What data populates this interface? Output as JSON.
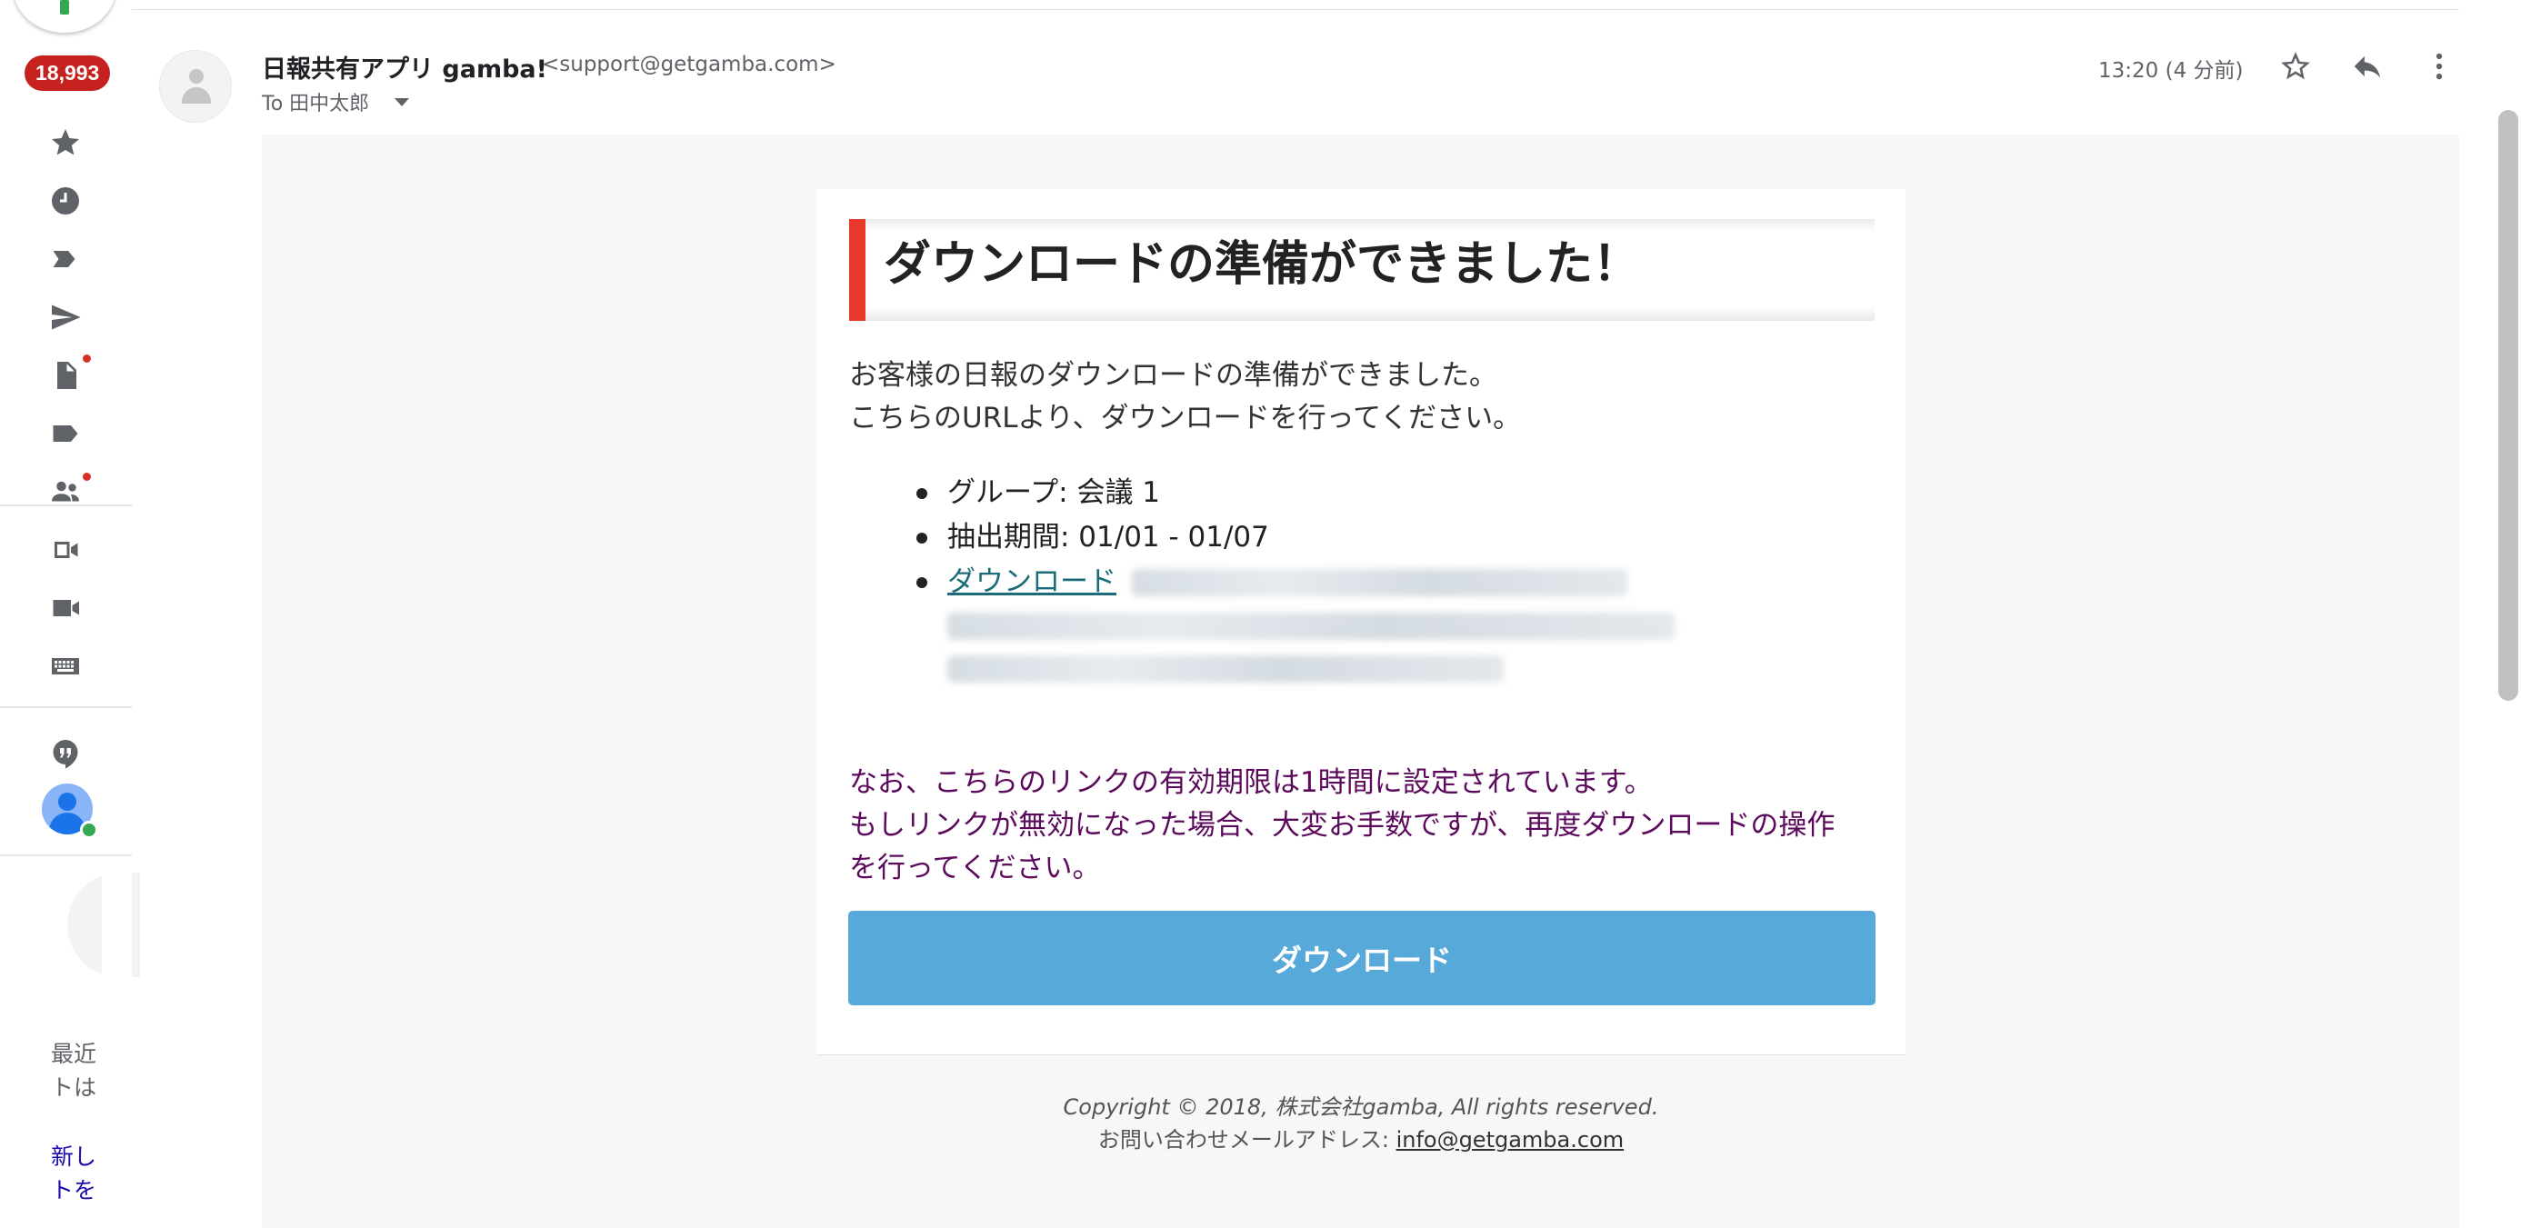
{
  "rail": {
    "unread_badge": "18,993",
    "icons": [
      "star-icon",
      "clock-icon",
      "important-icon",
      "send-icon",
      "draft-icon",
      "label-icon",
      "people-icon",
      "video-outline-icon",
      "video-icon",
      "keyboard-icon",
      "hangouts-icon"
    ],
    "recent_text_line1": "最近",
    "recent_text_line2": "トは",
    "new_link_line1": "新し",
    "new_link_line2": "トを"
  },
  "email": {
    "sender_name": "日報共有アプリ gamba!",
    "sender_email": "<support@getgamba.com>",
    "to_line": "To 田中太郎",
    "timestamp": "13:20 (4 分前)"
  },
  "body": {
    "title": "ダウンロードの準備ができました！",
    "intro_line1": "お客様の日報のダウンロードの準備ができました。",
    "intro_line2": "こちらのURLより、ダウンロードを行ってください。",
    "detail_group": "グループ: 会議 1",
    "detail_period": "抽出期間: 01/01 - 01/07",
    "detail_link_label": "ダウンロード",
    "notice_line1": "なお、こちらのリンクの有効期限は1時間に設定されています。",
    "notice_line2": "もしリンクが無効になった場合、大変お手数ですが、再度ダウンロードの操作",
    "notice_line3": "を行ってください。",
    "button_label": "ダウンロード"
  },
  "footer": {
    "copyright": "Copyright © 2018, 株式会社gamba, All rights reserved.",
    "contact_prefix": "お問い合わせメールアドレス: ",
    "contact_email": "info@getgamba.com"
  },
  "colors": {
    "accent_red": "#e8382c",
    "button_blue": "#57a9d9",
    "notice_purple": "#5c0a5c",
    "badge_red": "#c5221f",
    "link_teal": "#1a6d78"
  }
}
